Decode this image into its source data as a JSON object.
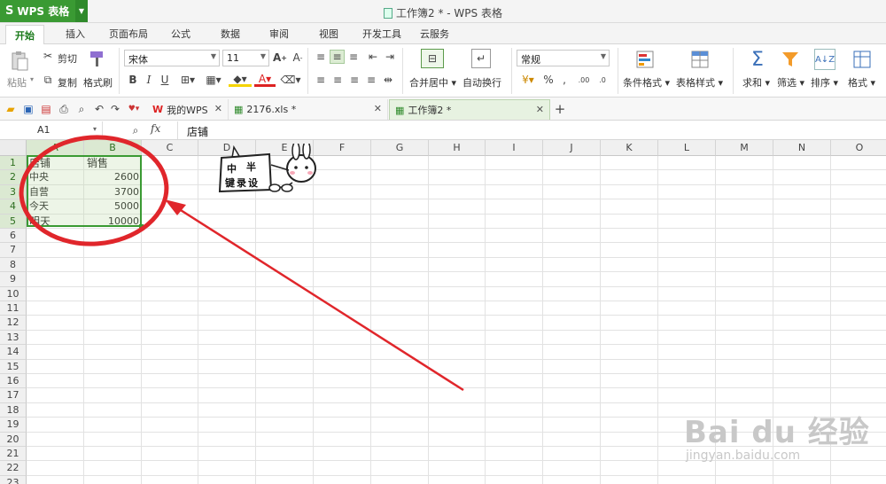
{
  "app": {
    "name": "WPS 表格",
    "window_title": "工作簿2 * - WPS 表格"
  },
  "tabs": [
    {
      "label": "开始",
      "active": true
    },
    {
      "label": "插入"
    },
    {
      "label": "页面布局"
    },
    {
      "label": "公式"
    },
    {
      "label": "数据"
    },
    {
      "label": "审阅"
    },
    {
      "label": "视图"
    },
    {
      "label": "开发工具"
    },
    {
      "label": "云服务"
    }
  ],
  "ribbon": {
    "paste": "粘贴",
    "cut": "剪切",
    "copy": "复制",
    "format_painter": "格式刷",
    "font_name": "宋体",
    "font_size": "11",
    "merge_center": "合并居中",
    "wrap_text": "自动换行",
    "number_format": "常规",
    "conditional_format": "条件格式",
    "table_style": "表格样式",
    "sum": "求和",
    "filter": "筛选",
    "sort": "排序",
    "format": "格式"
  },
  "doc_tabs": [
    {
      "label": "我的WPS"
    },
    {
      "label": "2176.xls *"
    },
    {
      "label": "工作簿2 *",
      "active": true
    }
  ],
  "formula_bar": {
    "cell_ref": "A1",
    "fx": "fx",
    "content": "店铺"
  },
  "columns": [
    "A",
    "B",
    "C",
    "D",
    "E",
    "F",
    "G",
    "H",
    "I",
    "J",
    "K",
    "L",
    "M",
    "N",
    "O"
  ],
  "rows": [
    "1",
    "2",
    "3",
    "4",
    "5",
    "6",
    "7",
    "8",
    "9",
    "10",
    "11",
    "12",
    "13",
    "14",
    "15",
    "16",
    "17",
    "18",
    "19",
    "20",
    "21",
    "22",
    "23"
  ],
  "cells": {
    "A1": "店铺",
    "B1": "销售",
    "A2": "中央",
    "B2": "2600",
    "A3": "自营",
    "B3": "3700",
    "A4": "今天",
    "B4": "5000",
    "A5": "明天",
    "B5": "10000"
  },
  "sticker": {
    "line1": "中",
    "line2": "半",
    "line3": "键录设"
  },
  "watermark": {
    "brand": "Bai du 经验",
    "url": "jingyan.baidu.com"
  },
  "colors": {
    "accent_green": "#3a9a33",
    "annotation_red": "#e0262b"
  }
}
